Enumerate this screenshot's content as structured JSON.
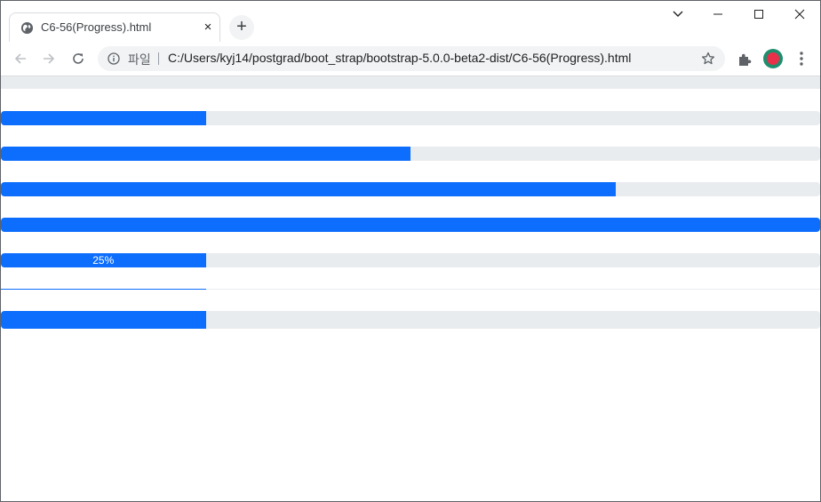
{
  "browser": {
    "tab": {
      "title": "C6-56(Progress).html",
      "close_glyph": "×"
    },
    "new_tab_glyph": "+",
    "window_controls": [
      "chevron-down-icon",
      "minimize-icon",
      "maximize-icon",
      "close-icon"
    ],
    "address_bar": {
      "scheme_label": "파일",
      "url": "C:/Users/kyj14/postgrad/boot_strap/bootstrap-5.0.0-beta2-dist/C6-56(Progress).html"
    },
    "colors": {
      "accent": "#0d6efd",
      "track": "#e9ecef",
      "avatar_ring": "#1e8e6e",
      "avatar_fill": "#e8304a"
    }
  },
  "page": {
    "progress_bars": [
      {
        "value_percent": 25,
        "label": ""
      },
      {
        "value_percent": 50,
        "label": ""
      },
      {
        "value_percent": 75,
        "label": ""
      },
      {
        "value_percent": 100,
        "label": ""
      },
      {
        "value_percent": 25,
        "label": "25%"
      },
      {
        "value_percent": 25,
        "label": ""
      },
      {
        "value_percent": 25,
        "label": ""
      }
    ]
  }
}
